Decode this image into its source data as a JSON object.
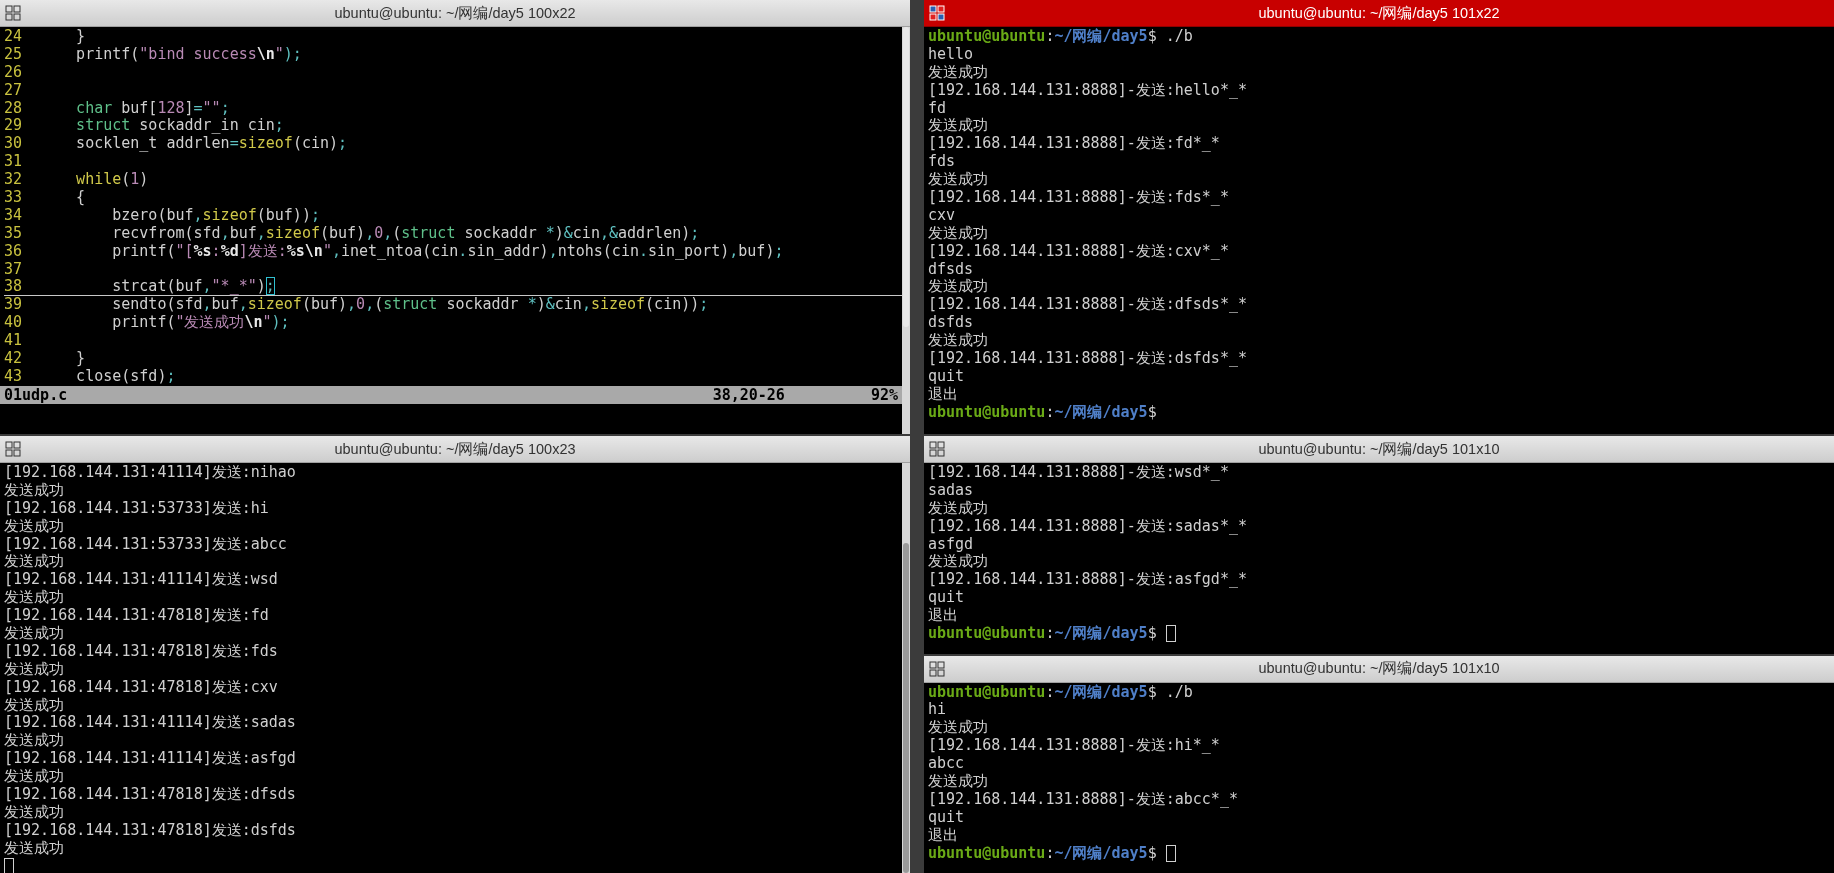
{
  "panes": [
    {
      "kind": "editor",
      "title": "ubuntu@ubuntu: ~/网编/day5 100x22",
      "focused": false,
      "code": [
        {
          "number": "24",
          "current": false,
          "segments": [
            {
              "text": "    }",
              "kind": "plain"
            }
          ]
        },
        {
          "number": "25",
          "current": false,
          "segments": [
            {
              "text": "    printf(",
              "kind": "plain"
            },
            {
              "text": "\"bind success",
              "kind": "string"
            },
            {
              "text": "\\n",
              "kind": "special"
            },
            {
              "text": "\"",
              "kind": "string"
            },
            {
              "text": ");",
              "kind": "op"
            }
          ]
        },
        {
          "number": "26",
          "current": false
        },
        {
          "number": "27",
          "current": false
        },
        {
          "number": "28",
          "current": false,
          "segments": [
            {
              "text": "    char",
              "kind": "type"
            },
            {
              "text": " buf[",
              "kind": "plain"
            },
            {
              "text": "128",
              "kind": "number"
            },
            {
              "text": "]",
              "kind": "plain"
            },
            {
              "text": "=",
              "kind": "op"
            },
            {
              "text": "\"\"",
              "kind": "string"
            },
            {
              "text": ";",
              "kind": "op"
            }
          ]
        },
        {
          "number": "29",
          "current": false,
          "segments": [
            {
              "text": "    struct",
              "kind": "type"
            },
            {
              "text": " sockaddr_in cin",
              "kind": "plain"
            },
            {
              "text": ";",
              "kind": "op"
            }
          ]
        },
        {
          "number": "30",
          "current": false,
          "segments": [
            {
              "text": "    socklen_t addrlen",
              "kind": "plain"
            },
            {
              "text": "=",
              "kind": "op"
            },
            {
              "text": "sizeof",
              "kind": "keyword"
            },
            {
              "text": "(cin)",
              "kind": "plain"
            },
            {
              "text": ";",
              "kind": "op"
            }
          ]
        },
        {
          "number": "31",
          "current": false
        },
        {
          "number": "32",
          "current": false,
          "segments": [
            {
              "text": "    while",
              "kind": "keyword"
            },
            {
              "text": "(",
              "kind": "plain"
            },
            {
              "text": "1",
              "kind": "number"
            },
            {
              "text": ")",
              "kind": "plain"
            }
          ]
        },
        {
          "number": "33",
          "current": false,
          "segments": [
            {
              "text": "    {",
              "kind": "plain"
            }
          ]
        },
        {
          "number": "34",
          "current": false,
          "segments": [
            {
              "text": "        bzero(buf",
              "kind": "plain"
            },
            {
              "text": ",",
              "kind": "op"
            },
            {
              "text": "sizeof",
              "kind": "keyword"
            },
            {
              "text": "(buf))",
              "kind": "plain"
            },
            {
              "text": ";",
              "kind": "op"
            }
          ]
        },
        {
          "number": "35",
          "current": false,
          "segments": [
            {
              "text": "        recvfrom(sfd",
              "kind": "plain"
            },
            {
              "text": ",",
              "kind": "op"
            },
            {
              "text": "buf",
              "kind": "plain"
            },
            {
              "text": ",",
              "kind": "op"
            },
            {
              "text": "sizeof",
              "kind": "keyword"
            },
            {
              "text": "(buf)",
              "kind": "plain"
            },
            {
              "text": ",",
              "kind": "op"
            },
            {
              "text": "0",
              "kind": "number"
            },
            {
              "text": ",",
              "kind": "op"
            },
            {
              "text": "(",
              "kind": "plain"
            },
            {
              "text": "struct",
              "kind": "type"
            },
            {
              "text": " sockaddr ",
              "kind": "plain"
            },
            {
              "text": "*",
              "kind": "op"
            },
            {
              "text": ")",
              "kind": "plain"
            },
            {
              "text": "&",
              "kind": "op"
            },
            {
              "text": "cin",
              "kind": "plain"
            },
            {
              "text": ",",
              "kind": "op"
            },
            {
              "text": "&",
              "kind": "op"
            },
            {
              "text": "addrlen)",
              "kind": "plain"
            },
            {
              "text": ";",
              "kind": "op"
            }
          ]
        },
        {
          "number": "36",
          "current": false,
          "segments": [
            {
              "text": "        printf(",
              "kind": "plain"
            },
            {
              "text": "\"[",
              "kind": "string"
            },
            {
              "text": "%s",
              "kind": "special"
            },
            {
              "text": ":",
              "kind": "string"
            },
            {
              "text": "%d",
              "kind": "special"
            },
            {
              "text": "]发送:",
              "kind": "string"
            },
            {
              "text": "%s",
              "kind": "special"
            },
            {
              "text": "\\n",
              "kind": "special"
            },
            {
              "text": "\"",
              "kind": "string"
            },
            {
              "text": ",",
              "kind": "op"
            },
            {
              "text": "inet_ntoa(cin",
              "kind": "plain"
            },
            {
              "text": ".",
              "kind": "op"
            },
            {
              "text": "sin_addr)",
              "kind": "plain"
            },
            {
              "text": ",",
              "kind": "op"
            },
            {
              "text": "ntohs(cin",
              "kind": "plain"
            },
            {
              "text": ".",
              "kind": "op"
            },
            {
              "text": "sin_port)",
              "kind": "plain"
            },
            {
              "text": ",",
              "kind": "op"
            },
            {
              "text": "buf)",
              "kind": "plain"
            },
            {
              "text": ";",
              "kind": "op"
            }
          ]
        },
        {
          "number": "37",
          "current": false
        },
        {
          "number": "38",
          "current": true,
          "segments": [
            {
              "text": "        strcat(buf",
              "kind": "plain"
            },
            {
              "text": ",",
              "kind": "op"
            },
            {
              "text": "\"*_*\"",
              "kind": "string"
            },
            {
              "text": ")",
              "kind": "plain"
            },
            {
              "text": ";",
              "kind": "cursor"
            }
          ]
        },
        {
          "number": "39",
          "current": false,
          "segments": [
            {
              "text": "        sendto(sfd",
              "kind": "plain"
            },
            {
              "text": ",",
              "kind": "op"
            },
            {
              "text": "buf",
              "kind": "plain"
            },
            {
              "text": ",",
              "kind": "op"
            },
            {
              "text": "sizeof",
              "kind": "keyword"
            },
            {
              "text": "(buf)",
              "kind": "plain"
            },
            {
              "text": ",",
              "kind": "op"
            },
            {
              "text": "0",
              "kind": "number"
            },
            {
              "text": ",",
              "kind": "op"
            },
            {
              "text": "(",
              "kind": "plain"
            },
            {
              "text": "struct",
              "kind": "type"
            },
            {
              "text": " sockaddr ",
              "kind": "plain"
            },
            {
              "text": "*",
              "kind": "op"
            },
            {
              "text": ")",
              "kind": "plain"
            },
            {
              "text": "&",
              "kind": "op"
            },
            {
              "text": "cin",
              "kind": "plain"
            },
            {
              "text": ",",
              "kind": "op"
            },
            {
              "text": "sizeof",
              "kind": "keyword"
            },
            {
              "text": "(cin))",
              "kind": "plain"
            },
            {
              "text": ";",
              "kind": "op"
            }
          ]
        },
        {
          "number": "40",
          "current": false,
          "segments": [
            {
              "text": "        printf(",
              "kind": "plain"
            },
            {
              "text": "\"发送成功",
              "kind": "string"
            },
            {
              "text": "\\n",
              "kind": "special"
            },
            {
              "text": "\"",
              "kind": "string"
            },
            {
              "text": ");",
              "kind": "op"
            }
          ]
        },
        {
          "number": "41",
          "current": false
        },
        {
          "number": "42",
          "current": false,
          "segments": [
            {
              "text": "    }",
              "kind": "plain"
            }
          ]
        },
        {
          "number": "43",
          "current": false,
          "segments": [
            {
              "text": "    close(sfd)",
              "kind": "plain"
            },
            {
              "text": ";",
              "kind": "op"
            }
          ]
        }
      ],
      "status": {
        "file": "01udp.c",
        "position": "38,20-26",
        "percent": "92%"
      }
    },
    {
      "kind": "terminal",
      "title": "ubuntu@ubuntu: ~/网编/day5 101x22",
      "focused": true,
      "lines": [
        {
          "kind": "prompt",
          "user": "ubuntu@ubuntu",
          "separator": ":",
          "path": "~/网编/day5",
          "tail": "$ ./b",
          "cursor": false
        },
        {
          "kind": "output",
          "text": "hello"
        },
        {
          "kind": "output",
          "text": "发送成功"
        },
        {
          "kind": "output",
          "text": "[192.168.144.131:8888]-发送:hello*_*"
        },
        {
          "kind": "output",
          "text": "fd"
        },
        {
          "kind": "output",
          "text": "发送成功"
        },
        {
          "kind": "output",
          "text": "[192.168.144.131:8888]-发送:fd*_*"
        },
        {
          "kind": "output",
          "text": "fds"
        },
        {
          "kind": "output",
          "text": "发送成功"
        },
        {
          "kind": "output",
          "text": "[192.168.144.131:8888]-发送:fds*_*"
        },
        {
          "kind": "output",
          "text": "cxv"
        },
        {
          "kind": "output",
          "text": "发送成功"
        },
        {
          "kind": "output",
          "text": "[192.168.144.131:8888]-发送:cxv*_*"
        },
        {
          "kind": "output",
          "text": "dfsds"
        },
        {
          "kind": "output",
          "text": "发送成功"
        },
        {
          "kind": "output",
          "text": "[192.168.144.131:8888]-发送:dfsds*_*"
        },
        {
          "kind": "output",
          "text": "dsfds"
        },
        {
          "kind": "output",
          "text": "发送成功"
        },
        {
          "kind": "output",
          "text": "[192.168.144.131:8888]-发送:dsfds*_*"
        },
        {
          "kind": "output",
          "text": "quit"
        },
        {
          "kind": "output",
          "text": "退出"
        },
        {
          "kind": "prompt",
          "user": "ubuntu@ubuntu",
          "separator": ":",
          "path": "~/网编/day5",
          "tail": "$",
          "cursor": false
        }
      ]
    },
    {
      "kind": "terminal",
      "title": "ubuntu@ubuntu: ~/网编/day5 100x23",
      "focused": false,
      "lines": [
        {
          "kind": "output",
          "text": "[192.168.144.131:41114]发送:nihao"
        },
        {
          "kind": "output",
          "text": "发送成功"
        },
        {
          "kind": "output",
          "text": "[192.168.144.131:53733]发送:hi"
        },
        {
          "kind": "output",
          "text": "发送成功"
        },
        {
          "kind": "output",
          "text": "[192.168.144.131:53733]发送:abcc"
        },
        {
          "kind": "output",
          "text": "发送成功"
        },
        {
          "kind": "output",
          "text": "[192.168.144.131:41114]发送:wsd"
        },
        {
          "kind": "output",
          "text": "发送成功"
        },
        {
          "kind": "output",
          "text": "[192.168.144.131:47818]发送:fd"
        },
        {
          "kind": "output",
          "text": "发送成功"
        },
        {
          "kind": "output",
          "text": "[192.168.144.131:47818]发送:fds"
        },
        {
          "kind": "output",
          "text": "发送成功"
        },
        {
          "kind": "output",
          "text": "[192.168.144.131:47818]发送:cxv"
        },
        {
          "kind": "output",
          "text": "发送成功"
        },
        {
          "kind": "output",
          "text": "[192.168.144.131:41114]发送:sadas"
        },
        {
          "kind": "output",
          "text": "发送成功"
        },
        {
          "kind": "output",
          "text": "[192.168.144.131:41114]发送:asfgd"
        },
        {
          "kind": "output",
          "text": "发送成功"
        },
        {
          "kind": "output",
          "text": "[192.168.144.131:47818]发送:dfsds"
        },
        {
          "kind": "output",
          "text": "发送成功"
        },
        {
          "kind": "output",
          "text": "[192.168.144.131:47818]发送:dsfds"
        },
        {
          "kind": "output",
          "text": "发送成功"
        },
        {
          "kind": "cursor"
        }
      ]
    },
    {
      "kind": "terminal",
      "title": "ubuntu@ubuntu: ~/网编/day5 101x10",
      "focused": false,
      "lines": [
        {
          "kind": "output",
          "text": "[192.168.144.131:8888]-发送:wsd*_*"
        },
        {
          "kind": "output",
          "text": "sadas"
        },
        {
          "kind": "output",
          "text": "发送成功"
        },
        {
          "kind": "output",
          "text": "[192.168.144.131:8888]-发送:sadas*_*"
        },
        {
          "kind": "output",
          "text": "asfgd"
        },
        {
          "kind": "output",
          "text": "发送成功"
        },
        {
          "kind": "output",
          "text": "[192.168.144.131:8888]-发送:asfgd*_*"
        },
        {
          "kind": "output",
          "text": "quit"
        },
        {
          "kind": "output",
          "text": "退出"
        },
        {
          "kind": "prompt",
          "user": "ubuntu@ubuntu",
          "separator": ":",
          "path": "~/网编/day5",
          "tail": "$",
          "cursor": true
        }
      ]
    },
    {
      "kind": "terminal",
      "title": "ubuntu@ubuntu: ~/网编/day5 101x10",
      "focused": false,
      "lines": [
        {
          "kind": "prompt",
          "user": "ubuntu@ubuntu",
          "separator": ":",
          "path": "~/网编/day5",
          "tail": "$ ./b",
          "cursor": false
        },
        {
          "kind": "output",
          "text": "hi"
        },
        {
          "kind": "output",
          "text": "发送成功"
        },
        {
          "kind": "output",
          "text": "[192.168.144.131:8888]-发送:hi*_*"
        },
        {
          "kind": "output",
          "text": "abcc"
        },
        {
          "kind": "output",
          "text": "发送成功"
        },
        {
          "kind": "output",
          "text": "[192.168.144.131:8888]-发送:abcc*_*"
        },
        {
          "kind": "output",
          "text": "quit"
        },
        {
          "kind": "output",
          "text": "退出"
        },
        {
          "kind": "prompt",
          "user": "ubuntu@ubuntu",
          "separator": ":",
          "path": "~/网编/day5",
          "tail": "$",
          "cursor": true
        }
      ]
    }
  ]
}
